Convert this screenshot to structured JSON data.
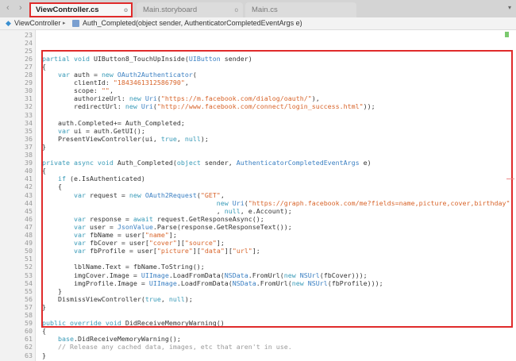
{
  "tabs": [
    {
      "label": "ViewController.cs",
      "active": true
    },
    {
      "label": "Main.storyboard",
      "active": false
    },
    {
      "label": "Main.cs",
      "active": false
    }
  ],
  "nav": {
    "back": "‹",
    "forward": "›",
    "menu": "▾"
  },
  "breadcrumb": {
    "class_name": "ViewController",
    "separator": "▸",
    "method": "Auth_Completed(object sender, AuthenticatorCompletedEventArgs e)"
  },
  "colors": {
    "highlight": "#e02b2b",
    "keyword": "#3a9bb8",
    "type": "#3a7fc2",
    "string": "#d8642a",
    "comment": "#9a9a9a"
  },
  "editor": {
    "first_line": 23,
    "lines": [
      [],
      [],
      [],
      [
        [
          "k",
          "partial void "
        ],
        [
          "p",
          "UIButton8_TouchUpInside("
        ],
        [
          "t",
          "UIButton"
        ],
        [
          "p",
          " sender)"
        ]
      ],
      [
        [
          "p",
          "{"
        ]
      ],
      [
        [
          "k",
          "    var "
        ],
        [
          "p",
          "auth = "
        ],
        [
          "k",
          "new "
        ],
        [
          "t",
          "OAuth2Authenticator"
        ],
        [
          "p",
          "("
        ]
      ],
      [
        [
          "p",
          "        clientId: "
        ],
        [
          "s",
          "\"1843461312586790\""
        ],
        [
          "p",
          ","
        ]
      ],
      [
        [
          "p",
          "        scope: "
        ],
        [
          "s",
          "\"\""
        ],
        [
          "p",
          ","
        ]
      ],
      [
        [
          "p",
          "        authorizeUrl: "
        ],
        [
          "k",
          "new "
        ],
        [
          "t",
          "Uri"
        ],
        [
          "p",
          "("
        ],
        [
          "s",
          "\"https://m.facebook.com/dialog/oauth/\""
        ],
        [
          "p",
          "),"
        ]
      ],
      [
        [
          "p",
          "        redirectUrl: "
        ],
        [
          "k",
          "new "
        ],
        [
          "t",
          "Uri"
        ],
        [
          "p",
          "("
        ],
        [
          "s",
          "\"http://www.facebook.com/connect/login_success.html\""
        ],
        [
          "p",
          "));"
        ]
      ],
      [],
      [
        [
          "p",
          "    auth.Completed+= Auth_Completed;"
        ]
      ],
      [
        [
          "k",
          "    var "
        ],
        [
          "p",
          "ui = auth.GetUI();"
        ]
      ],
      [
        [
          "p",
          "    PresentViewController(ui, "
        ],
        [
          "k",
          "true"
        ],
        [
          "p",
          ", "
        ],
        [
          "k",
          "null"
        ],
        [
          "p",
          ");"
        ]
      ],
      [
        [
          "p",
          "}"
        ]
      ],
      [],
      [
        [
          "k",
          "private async void "
        ],
        [
          "p",
          "Auth_Completed("
        ],
        [
          "k",
          "object "
        ],
        [
          "p",
          "sender, "
        ],
        [
          "t",
          "AuthenticatorCompletedEventArgs"
        ],
        [
          "p",
          " e)"
        ]
      ],
      [
        [
          "p",
          "{"
        ]
      ],
      [
        [
          "k",
          "    if "
        ],
        [
          "p",
          "(e.IsAuthenticated)"
        ]
      ],
      [
        [
          "p",
          "    {"
        ]
      ],
      [
        [
          "k",
          "        var "
        ],
        [
          "p",
          "request = "
        ],
        [
          "k",
          "new "
        ],
        [
          "t",
          "OAuth2Request"
        ],
        [
          "p",
          "("
        ],
        [
          "s",
          "\"GET\""
        ],
        [
          "p",
          ","
        ]
      ],
      [
        [
          "k",
          "                                            new "
        ],
        [
          "t",
          "Uri"
        ],
        [
          "p",
          "("
        ],
        [
          "s",
          "\"https://graph.facebook.com/me?fields=name,picture,cover,birthday\""
        ],
        [
          "p",
          ")"
        ]
      ],
      [
        [
          "p",
          "                                            , "
        ],
        [
          "k",
          "null"
        ],
        [
          "p",
          ", e.Account);"
        ]
      ],
      [
        [
          "k",
          "        var "
        ],
        [
          "p",
          "response = "
        ],
        [
          "k",
          "await "
        ],
        [
          "p",
          "request.GetResponseAsync();"
        ]
      ],
      [
        [
          "k",
          "        var "
        ],
        [
          "p",
          "user = "
        ],
        [
          "t",
          "JsonValue"
        ],
        [
          "p",
          ".Parse(response.GetResponseText());"
        ]
      ],
      [
        [
          "k",
          "        var "
        ],
        [
          "p",
          "fbName = user["
        ],
        [
          "s",
          "\"name\""
        ],
        [
          "p",
          "];"
        ]
      ],
      [
        [
          "k",
          "        var "
        ],
        [
          "p",
          "fbCover = user["
        ],
        [
          "s",
          "\"cover\""
        ],
        [
          "p",
          "]["
        ],
        [
          "s",
          "\"source\""
        ],
        [
          "p",
          "];"
        ]
      ],
      [
        [
          "k",
          "        var "
        ],
        [
          "p",
          "fbProfile = user["
        ],
        [
          "s",
          "\"picture\""
        ],
        [
          "p",
          "]["
        ],
        [
          "s",
          "\"data\""
        ],
        [
          "p",
          "]["
        ],
        [
          "s",
          "\"url\""
        ],
        [
          "p",
          "];"
        ]
      ],
      [],
      [
        [
          "p",
          "        lblName.Text = fbName.ToString();"
        ]
      ],
      [
        [
          "p",
          "        imgCover.Image = "
        ],
        [
          "t",
          "UIImage"
        ],
        [
          "p",
          ".LoadFromData("
        ],
        [
          "t",
          "NSData"
        ],
        [
          "p",
          ".FromUrl("
        ],
        [
          "k",
          "new "
        ],
        [
          "t",
          "NSUrl"
        ],
        [
          "p",
          "(fbCover)));"
        ]
      ],
      [
        [
          "p",
          "        imgProfile.Image = "
        ],
        [
          "t",
          "UIImage"
        ],
        [
          "p",
          ".LoadFromData("
        ],
        [
          "t",
          "NSData"
        ],
        [
          "p",
          ".FromUrl("
        ],
        [
          "k",
          "new "
        ],
        [
          "t",
          "NSUrl"
        ],
        [
          "p",
          "(fbProfile)));"
        ]
      ],
      [
        [
          "p",
          "    }"
        ]
      ],
      [
        [
          "p",
          "    DismissViewController("
        ],
        [
          "k",
          "true"
        ],
        [
          "p",
          ", "
        ],
        [
          "k",
          "null"
        ],
        [
          "p",
          ");"
        ]
      ],
      [
        [
          "p",
          "}"
        ]
      ],
      [],
      [
        [
          "k",
          "public override void "
        ],
        [
          "p",
          "DidReceiveMemoryWarning()"
        ]
      ],
      [
        [
          "p",
          "{"
        ]
      ],
      [
        [
          "k",
          "    base"
        ],
        [
          "p",
          ".DidReceiveMemoryWarning();"
        ]
      ],
      [
        [
          "c",
          "    // Release any cached data, images, etc that aren't in use."
        ]
      ],
      [
        [
          "p",
          "}"
        ]
      ]
    ]
  }
}
